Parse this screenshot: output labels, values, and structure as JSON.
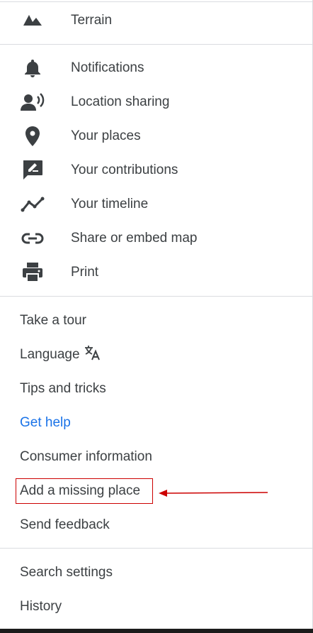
{
  "menu": {
    "top": [
      {
        "id": "terrain",
        "label": "Terrain",
        "icon": "terrain-icon"
      }
    ],
    "apps": [
      {
        "id": "notifications",
        "label": "Notifications",
        "icon": "bell-icon"
      },
      {
        "id": "location-sharing",
        "label": "Location sharing",
        "icon": "location-sharing-icon"
      },
      {
        "id": "your-places",
        "label": "Your places",
        "icon": "pin-icon"
      },
      {
        "id": "your-contributions",
        "label": "Your contributions",
        "icon": "edit-feedback-icon"
      },
      {
        "id": "your-timeline",
        "label": "Your timeline",
        "icon": "timeline-icon"
      },
      {
        "id": "share-embed",
        "label": "Share or embed map",
        "icon": "link-icon"
      },
      {
        "id": "print",
        "label": "Print",
        "icon": "print-icon"
      }
    ],
    "help": [
      {
        "id": "take-a-tour",
        "label": "Take a tour"
      },
      {
        "id": "language",
        "label": "Language",
        "icon": "translate-icon"
      },
      {
        "id": "tips-and-tricks",
        "label": "Tips and tricks"
      },
      {
        "id": "get-help",
        "label": "Get help",
        "color": "#1a73e8"
      },
      {
        "id": "consumer-information",
        "label": "Consumer information"
      },
      {
        "id": "add-missing-place",
        "label": "Add a missing place",
        "highlighted": true
      },
      {
        "id": "send-feedback",
        "label": "Send feedback"
      }
    ],
    "settings": [
      {
        "id": "search-settings",
        "label": "Search settings"
      },
      {
        "id": "history",
        "label": "History"
      }
    ]
  },
  "annotation": {
    "color": "#cc0000",
    "target": "add-missing-place"
  }
}
